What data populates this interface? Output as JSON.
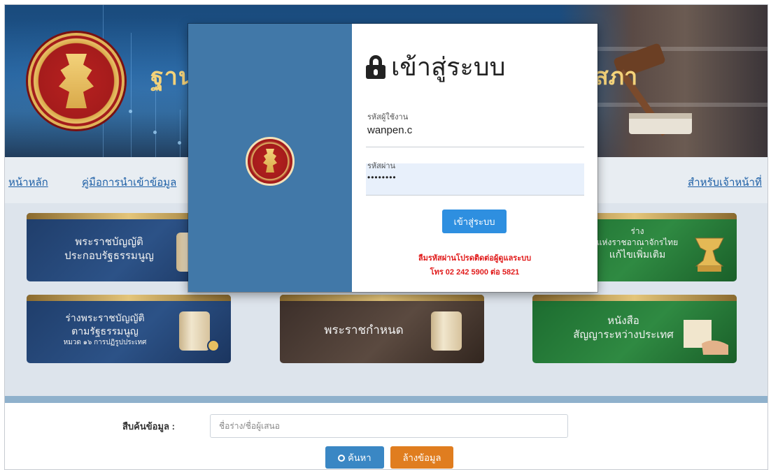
{
  "banner": {
    "title_left": "ฐาน",
    "title_right": "สภา"
  },
  "nav": {
    "home": "หน้าหลัก",
    "manual": "คู่มือการนำเข้าข้อมูล",
    "staff": "สำหรับเจ้าหน้าที่"
  },
  "tiles": [
    {
      "line1": "พระราชบัญญัติ",
      "line2": "ประกอบรัฐธรรมนูญ"
    },
    {
      "line1": "ร่าง",
      "line2": "แห่งราชอาณาจักรไทย",
      "line3": "แก้ไขเพิ่มเติม"
    },
    {
      "line1": "ร่างพระราชบัญญัติ",
      "line2": "ตามรัฐธรรมนูญ",
      "line3": "หมวด ๑๖ การปฏิรูปประเทศ"
    },
    {
      "line1": "พระราชกำหนด"
    },
    {
      "line1": "หนังสือ",
      "line2": "สัญญาระหว่างประเทศ"
    }
  ],
  "search": {
    "label": "สืบค้นข้อมูล :",
    "placeholder": "ชื่อร่าง/ชื่อผู้เสนอ",
    "search_button": "ค้นหา",
    "clear_button": "ล้างข้อมูล"
  },
  "login": {
    "title": "เข้าสู่ระบบ",
    "username_label": "รหัสผู้ใช้งาน",
    "username_value": "wanpen.c",
    "password_label": "รหัสผ่าน",
    "password_value": "••••••••",
    "button": "เข้าสู่ระบบ",
    "note_line1": "ลืมรหัสผ่านโปรดติดต่อผู้ดูแลระบบ",
    "note_line2": "โทร 02 242 5900 ต่อ 5821"
  }
}
